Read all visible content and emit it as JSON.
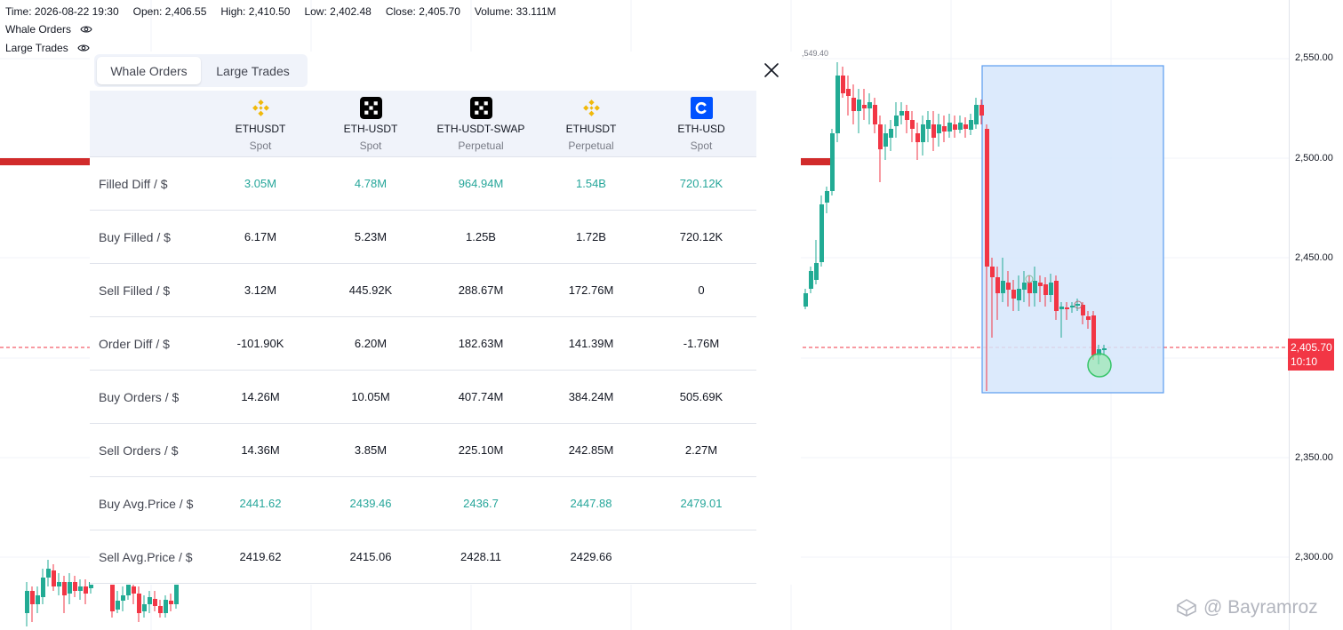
{
  "info_bar": {
    "time": "Time: 2026-08-22 19:30",
    "open": "Open: 2,406.55",
    "high": "High: 2,410.50",
    "low": "Low: 2,402.48",
    "close": "Close: 2,405.70",
    "volume": "Volume: 33.111M"
  },
  "indicators": [
    {
      "label": "Whale Orders",
      "icon": "eye-icon"
    },
    {
      "label": "Large Trades",
      "icon": "eye-icon"
    }
  ],
  "price_axis": {
    "labels": [
      "2,550.00",
      "2,500.00",
      "2,450.00",
      "2,350.00",
      "2,300.00"
    ],
    "current_price": "2,405.70",
    "countdown": "10:10",
    "peak_label": ",549.40"
  },
  "colors": {
    "up": "#26a69a",
    "candle_up": "#22ab94",
    "candle_down": "#f23645",
    "accent_blue": "#2962ff",
    "selection_fill": "#d6e6fb",
    "selection_border": "#5b9cf0"
  },
  "panel": {
    "tabs": [
      {
        "label": "Whale Orders",
        "active": true
      },
      {
        "label": "Large Trades",
        "active": false
      }
    ],
    "columns": [
      {
        "exchange_icon": "binance-icon",
        "symbol": "ETHUSDT",
        "type": "Spot"
      },
      {
        "exchange_icon": "okx-icon",
        "symbol": "ETH-USDT",
        "type": "Spot"
      },
      {
        "exchange_icon": "okx-icon",
        "symbol": "ETH-USDT-SWAP",
        "type": "Perpetual"
      },
      {
        "exchange_icon": "binance-icon",
        "symbol": "ETHUSDT",
        "type": "Perpetual"
      },
      {
        "exchange_icon": "coinbase-icon",
        "symbol": "ETH-USD",
        "type": "Spot"
      }
    ],
    "rows": [
      {
        "label": "Filled Diff / $",
        "highlight": true,
        "values": [
          "3.05M",
          "4.78M",
          "964.94M",
          "1.54B",
          "720.12K"
        ]
      },
      {
        "label": "Buy Filled / $",
        "highlight": false,
        "values": [
          "6.17M",
          "5.23M",
          "1.25B",
          "1.72B",
          "720.12K"
        ]
      },
      {
        "label": "Sell Filled / $",
        "highlight": false,
        "values": [
          "3.12M",
          "445.92K",
          "288.67M",
          "172.76M",
          "0"
        ]
      },
      {
        "label": "Order Diff / $",
        "highlight": false,
        "values": [
          "-101.90K",
          "6.20M",
          "182.63M",
          "141.39M",
          "-1.76M"
        ]
      },
      {
        "label": "Buy Orders / $",
        "highlight": false,
        "values": [
          "14.26M",
          "10.05M",
          "407.74M",
          "384.24M",
          "505.69K"
        ]
      },
      {
        "label": "Sell Orders / $",
        "highlight": false,
        "values": [
          "14.36M",
          "3.85M",
          "225.10M",
          "242.85M",
          "2.27M"
        ]
      },
      {
        "label": "Buy Avg.Price / $",
        "highlight": true,
        "values": [
          "2441.62",
          "2439.46",
          "2436.7",
          "2447.88",
          "2479.01"
        ]
      },
      {
        "label": "Sell Avg.Price / $",
        "highlight": false,
        "values": [
          "2419.62",
          "2415.06",
          "2428.11",
          "2429.66",
          ""
        ]
      }
    ]
  },
  "watermark": "@ Bayramroz"
}
